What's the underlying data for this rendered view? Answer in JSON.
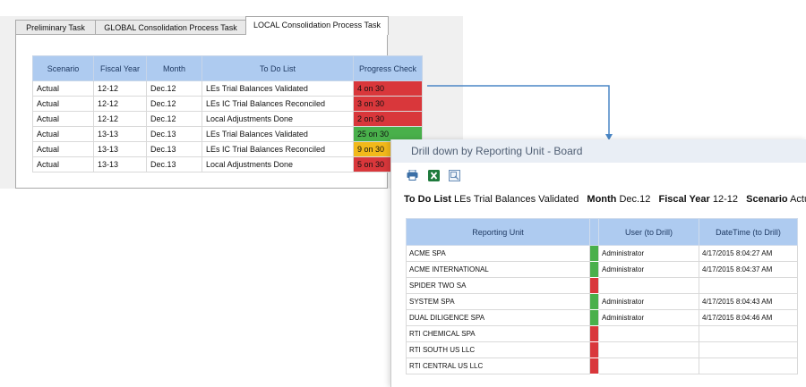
{
  "tabs": [
    {
      "label": "Preliminary Task"
    },
    {
      "label": "GLOBAL Consolidation Process Task"
    },
    {
      "label": "LOCAL Consolidation Process Task"
    }
  ],
  "task_grid": {
    "columns": [
      "Scenario",
      "Fiscal Year",
      "Month",
      "To Do List",
      "Progress Check"
    ],
    "rows": [
      {
        "scenario": "Actual",
        "fiscal_year": "12-12",
        "month": "Dec.12",
        "todo": "LEs Trial Balances Validated",
        "progress": "4 on 30",
        "status": "red"
      },
      {
        "scenario": "Actual",
        "fiscal_year": "12-12",
        "month": "Dec.12",
        "todo": "LEs IC Trial Balances Reconciled",
        "progress": "3 on 30",
        "status": "red"
      },
      {
        "scenario": "Actual",
        "fiscal_year": "12-12",
        "month": "Dec.12",
        "todo": "Local Adjustments Done",
        "progress": "2 on 30",
        "status": "red"
      },
      {
        "scenario": "Actual",
        "fiscal_year": "13-13",
        "month": "Dec.13",
        "todo": "LEs Trial Balances Validated",
        "progress": "25 on 30",
        "status": "green"
      },
      {
        "scenario": "Actual",
        "fiscal_year": "13-13",
        "month": "Dec.13",
        "todo": "LEs IC Trial Balances Reconciled",
        "progress": "9 on 30",
        "status": "amber"
      },
      {
        "scenario": "Actual",
        "fiscal_year": "13-13",
        "month": "Dec.13",
        "todo": "Local Adjustments Done",
        "progress": "5 on 30",
        "status": "red"
      }
    ]
  },
  "drill_window": {
    "title": "Drill down by Reporting Unit - Board",
    "toolbar": [
      "print-icon",
      "excel-export-icon",
      "view-icon"
    ],
    "criteria": {
      "todo_label": "To Do List",
      "todo_value": "LEs Trial Balances Validated",
      "month_label": "Month",
      "month_value": "Dec.12",
      "fy_label": "Fiscal Year",
      "fy_value": "12-12",
      "scenario_label": "Scenario",
      "scenario_value": "Actual"
    },
    "columns": [
      "Reporting Unit",
      "",
      "User (to Drill)",
      "DateTime (to Drill)"
    ],
    "rows": [
      {
        "unit": "ACME SPA",
        "status": "green",
        "user": "Administrator",
        "datetime": "4/17/2015 8:04:27 AM"
      },
      {
        "unit": "ACME INTERNATIONAL",
        "status": "green",
        "user": "Administrator",
        "datetime": "4/17/2015 8:04:37 AM"
      },
      {
        "unit": "SPIDER TWO SA",
        "status": "red",
        "user": "",
        "datetime": ""
      },
      {
        "unit": "SYSTEM SPA",
        "status": "green",
        "user": "Administrator",
        "datetime": "4/17/2015 8:04:43 AM"
      },
      {
        "unit": "DUAL DILIGENCE SPA",
        "status": "green",
        "user": "Administrator",
        "datetime": "4/17/2015 8:04:46 AM"
      },
      {
        "unit": "RTI CHEMICAL SPA",
        "status": "red",
        "user": "",
        "datetime": ""
      },
      {
        "unit": "RTI SOUTH US LLC",
        "status": "red",
        "user": "",
        "datetime": ""
      },
      {
        "unit": "RTI CENTRAL US LLC",
        "status": "red",
        "user": "",
        "datetime": ""
      }
    ]
  },
  "colors": {
    "red": "#d9373b",
    "green": "#49b04b",
    "amber": "#f2b91b",
    "header": "#aecbf0",
    "connector": "#4a86c5"
  }
}
